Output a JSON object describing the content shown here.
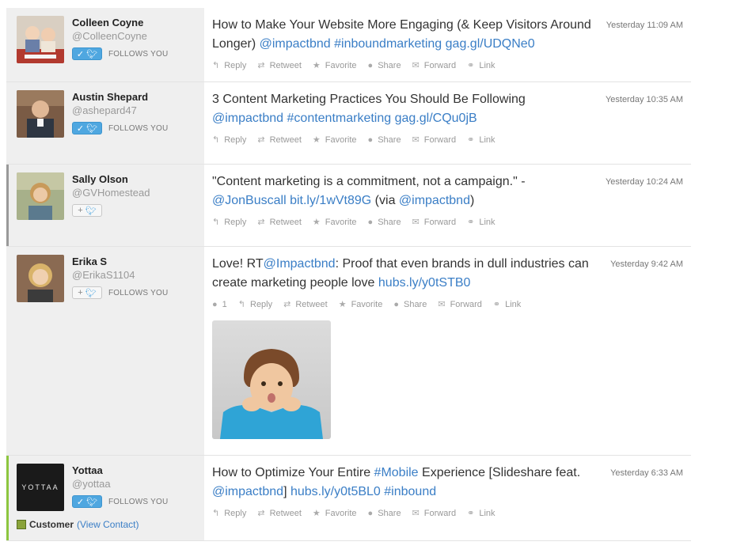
{
  "actions": {
    "reply": "Reply",
    "retweet": "Retweet",
    "favorite": "Favorite",
    "share": "Share",
    "forward": "Forward",
    "link": "Link"
  },
  "follow_badge": "FOLLOWS YOU",
  "posts": [
    {
      "name": "Colleen Coyne",
      "handle": "@ColleenCoyne",
      "time": "Yesterday 11:09 AM",
      "follows_you": true,
      "text_parts": [
        "How to Make Your Website More Engaging (& Keep Visitors Around Longer) ",
        "@impactbnd",
        " ",
        "#inboundmarketing",
        " ",
        "gag.gl/UDQNe0"
      ]
    },
    {
      "name": "Austin Shepard",
      "handle": "@ashepard47",
      "time": "Yesterday 10:35 AM",
      "follows_you": true,
      "text_parts": [
        "3 Content Marketing Practices You Should Be Following ",
        "@impactbnd",
        " ",
        "#contentmarketing",
        " ",
        "gag.gl/CQu0jB"
      ]
    },
    {
      "name": "Sally Olson",
      "handle": "@GVHomestead",
      "time": "Yesterday 10:24 AM",
      "follows_you": false,
      "text_parts": [
        "\"Content marketing is a commitment, not a campaign.\" - ",
        "@JonBuscall",
        " ",
        "bit.ly/1wVt89G",
        " (via ",
        "@impactbnd",
        ")"
      ]
    },
    {
      "name": "Erika S",
      "handle": "@ErikaS1104",
      "time": "Yesterday 9:42 AM",
      "follows_you": true,
      "reply_count": "1",
      "text_parts": [
        "Love! RT",
        "@Impactbnd",
        ": Proof that even brands in dull industries can create marketing people love ",
        "hubs.ly/y0tSTB0"
      ]
    },
    {
      "name": "Yottaa",
      "handle": "@yottaa",
      "time": "Yesterday 6:33 AM",
      "follows_you": true,
      "logo_text": "YOTTAA",
      "customer_label": "Customer",
      "customer_link": "(View Contact)",
      "text_parts": [
        "How to Optimize Your Entire ",
        "#Mobile",
        " Experience [Slideshare feat. ",
        "@impactbnd",
        "] ",
        "hubs.ly/y0t5BL0",
        " ",
        "#inbound"
      ]
    }
  ],
  "colors": {
    "link": "#3a7ec6",
    "twitter": "#4fa7e0",
    "customer_green": "#8aa33a",
    "left_panel": "#efefef"
  }
}
